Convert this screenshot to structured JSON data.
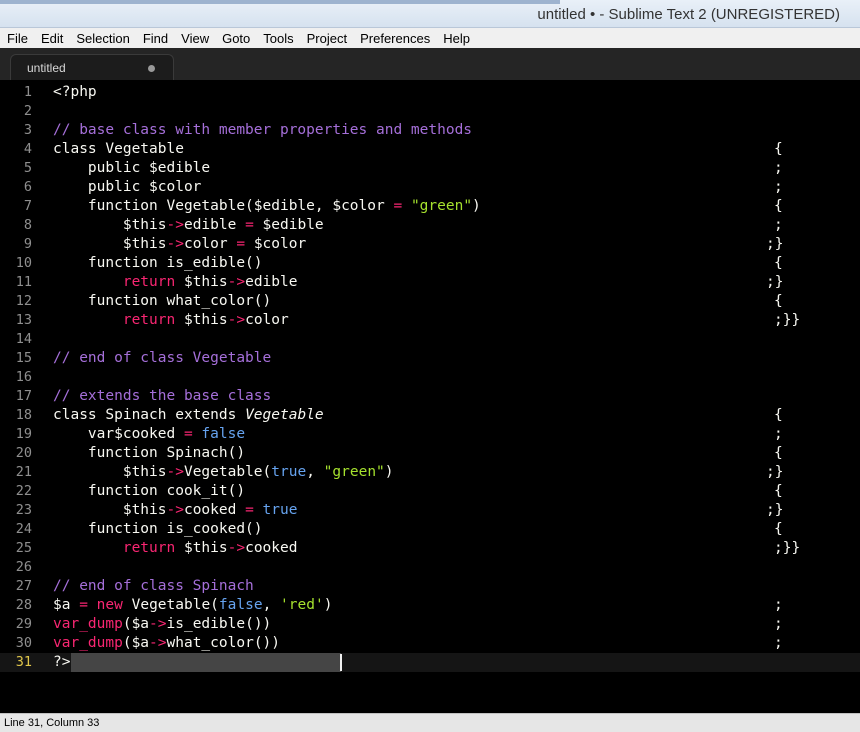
{
  "window": {
    "title": "untitled • - Sublime Text 2 (UNREGISTERED)"
  },
  "menu": [
    "File",
    "Edit",
    "Selection",
    "Find",
    "View",
    "Goto",
    "Tools",
    "Project",
    "Preferences",
    "Help"
  ],
  "tab": {
    "label": "untitled",
    "modified_indicator": "dot-icon"
  },
  "editor": {
    "current_line": 31,
    "lines": [
      {
        "n": "1",
        "code": [
          [
            "t",
            "<?php"
          ]
        ],
        "brace": ""
      },
      {
        "n": "2",
        "code": [],
        "brace": ""
      },
      {
        "n": "3",
        "code": [
          [
            "cm",
            "// base class with member properties and methods"
          ]
        ],
        "brace": ""
      },
      {
        "n": "4",
        "code": [
          [
            "t",
            "class Vegetable"
          ]
        ],
        "brace": "{"
      },
      {
        "n": "5",
        "code": [
          [
            "t",
            "    public $edible"
          ]
        ],
        "brace": ";"
      },
      {
        "n": "6",
        "code": [
          [
            "t",
            "    public $color"
          ]
        ],
        "brace": ";"
      },
      {
        "n": "7",
        "code": [
          [
            "t",
            "    function Vegetable($edible, $color "
          ],
          [
            "kw",
            "="
          ],
          [
            "t",
            " "
          ],
          [
            "st",
            "\"green\""
          ],
          [
            "t",
            ")"
          ]
        ],
        "brace": "{"
      },
      {
        "n": "8",
        "code": [
          [
            "t",
            "        $this"
          ],
          [
            "kw",
            "->"
          ],
          [
            "t",
            "edible "
          ],
          [
            "kw",
            "="
          ],
          [
            "t",
            " $edible"
          ]
        ],
        "brace": ";"
      },
      {
        "n": "9",
        "code": [
          [
            "t",
            "        $this"
          ],
          [
            "kw",
            "->"
          ],
          [
            "t",
            "color "
          ],
          [
            "kw",
            "="
          ],
          [
            "t",
            " $color"
          ]
        ],
        "brace": ";}"
      },
      {
        "n": "10",
        "code": [
          [
            "t",
            "    function is_edible()"
          ]
        ],
        "brace": "{"
      },
      {
        "n": "11",
        "code": [
          [
            "t",
            "        "
          ],
          [
            "kw",
            "return"
          ],
          [
            "t",
            " $this"
          ],
          [
            "kw",
            "->"
          ],
          [
            "t",
            "edible"
          ]
        ],
        "brace": ";}"
      },
      {
        "n": "12",
        "code": [
          [
            "t",
            "    function what_color()"
          ]
        ],
        "brace": "{"
      },
      {
        "n": "13",
        "code": [
          [
            "t",
            "        "
          ],
          [
            "kw",
            "return"
          ],
          [
            "t",
            " $this"
          ],
          [
            "kw",
            "->"
          ],
          [
            "t",
            "color"
          ]
        ],
        "brace": ";}}"
      },
      {
        "n": "14",
        "code": [],
        "brace": ""
      },
      {
        "n": "15",
        "code": [
          [
            "cm",
            "// end of class Vegetable"
          ]
        ],
        "brace": ""
      },
      {
        "n": "16",
        "code": [],
        "brace": ""
      },
      {
        "n": "17",
        "code": [
          [
            "cm",
            "// extends the base class"
          ]
        ],
        "brace": ""
      },
      {
        "n": "18",
        "code": [
          [
            "t",
            "class Spinach extends "
          ],
          [
            "it",
            "Vegetable"
          ]
        ],
        "brace": "{"
      },
      {
        "n": "19",
        "code": [
          [
            "t",
            "    var$cooked "
          ],
          [
            "kw",
            "="
          ],
          [
            "t",
            " "
          ],
          [
            "bo",
            "false"
          ]
        ],
        "brace": ";"
      },
      {
        "n": "20",
        "code": [
          [
            "t",
            "    function Spinach()"
          ]
        ],
        "brace": "{"
      },
      {
        "n": "21",
        "code": [
          [
            "t",
            "        $this"
          ],
          [
            "kw",
            "->"
          ],
          [
            "t",
            "Vegetable("
          ],
          [
            "bo",
            "true"
          ],
          [
            "t",
            ", "
          ],
          [
            "st",
            "\"green\""
          ],
          [
            "t",
            ")"
          ]
        ],
        "brace": ";}"
      },
      {
        "n": "22",
        "code": [
          [
            "t",
            "    function cook_it()"
          ]
        ],
        "brace": "{"
      },
      {
        "n": "23",
        "code": [
          [
            "t",
            "        $this"
          ],
          [
            "kw",
            "->"
          ],
          [
            "t",
            "cooked "
          ],
          [
            "kw",
            "="
          ],
          [
            "t",
            " "
          ],
          [
            "bo",
            "true"
          ]
        ],
        "brace": ";}"
      },
      {
        "n": "24",
        "code": [
          [
            "t",
            "    function is_cooked()"
          ]
        ],
        "brace": "{"
      },
      {
        "n": "25",
        "code": [
          [
            "t",
            "        "
          ],
          [
            "kw",
            "return"
          ],
          [
            "t",
            " $this"
          ],
          [
            "kw",
            "->"
          ],
          [
            "t",
            "cooked"
          ]
        ],
        "brace": ";}}"
      },
      {
        "n": "26",
        "code": [],
        "brace": ""
      },
      {
        "n": "27",
        "code": [
          [
            "cm",
            "// end of class Spinach"
          ]
        ],
        "brace": ""
      },
      {
        "n": "28",
        "code": [
          [
            "t",
            "$a "
          ],
          [
            "kw",
            "="
          ],
          [
            "t",
            " "
          ],
          [
            "kw",
            "new"
          ],
          [
            "t",
            " Vegetable("
          ],
          [
            "bo",
            "false"
          ],
          [
            "t",
            ", "
          ],
          [
            "st",
            "'red'"
          ],
          [
            "t",
            ")"
          ]
        ],
        "brace": ";"
      },
      {
        "n": "29",
        "code": [
          [
            "kw",
            "var_dump"
          ],
          [
            "t",
            "($a"
          ],
          [
            "kw",
            "->"
          ],
          [
            "t",
            "is_edible())"
          ]
        ],
        "brace": ";"
      },
      {
        "n": "30",
        "code": [
          [
            "kw",
            "var_dump"
          ],
          [
            "t",
            "($a"
          ],
          [
            "kw",
            "->"
          ],
          [
            "t",
            "what_color())"
          ]
        ],
        "brace": ";"
      },
      {
        "n": "31",
        "code": [
          [
            "t",
            "?>"
          ]
        ],
        "brace": ""
      }
    ]
  },
  "status": {
    "text": "Line 31, Column 33"
  }
}
